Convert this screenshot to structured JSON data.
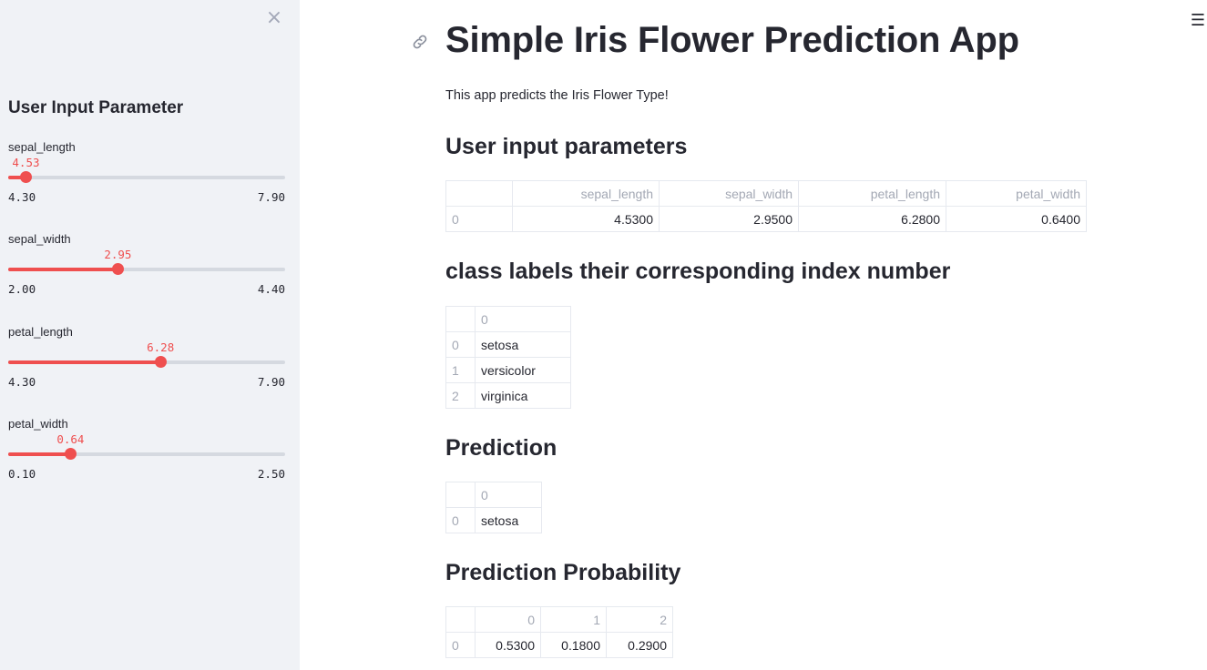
{
  "sidebar": {
    "close_glyph": "×",
    "title": "User Input Parameter",
    "sliders": [
      {
        "label": "sepal_length",
        "value": "4.53",
        "min": "4.30",
        "max": "7.90",
        "fraction": 0.064
      },
      {
        "label": "sepal_width",
        "value": "2.95",
        "min": "2.00",
        "max": "4.40",
        "fraction": 0.396
      },
      {
        "label": "petal_length",
        "value": "6.28",
        "min": "4.30",
        "max": "7.90",
        "fraction": 0.55
      },
      {
        "label": "petal_width",
        "value": "0.64",
        "min": "0.10",
        "max": "2.50",
        "fraction": 0.225
      }
    ]
  },
  "main": {
    "menu_glyph": "☰",
    "title": "Simple Iris Flower Prediction App",
    "intro": "This app predicts the Iris Flower Type!",
    "input_section": {
      "heading": "User input parameters",
      "columns": [
        "sepal_length",
        "sepal_width",
        "petal_length",
        "petal_width"
      ],
      "rows": [
        {
          "index": "0",
          "cells": [
            "4.5300",
            "2.9500",
            "6.2800",
            "0.6400"
          ]
        }
      ]
    },
    "labels_section": {
      "heading": "class labels their corresponding index number",
      "columns": [
        "0"
      ],
      "rows": [
        {
          "index": "0",
          "cells": [
            "setosa"
          ]
        },
        {
          "index": "1",
          "cells": [
            "versicolor"
          ]
        },
        {
          "index": "2",
          "cells": [
            "virginica"
          ]
        }
      ]
    },
    "prediction_section": {
      "heading": "Prediction",
      "columns": [
        "0"
      ],
      "rows": [
        {
          "index": "0",
          "cells": [
            "setosa"
          ]
        }
      ]
    },
    "probability_section": {
      "heading": "Prediction Probability",
      "columns": [
        "0",
        "1",
        "2"
      ],
      "rows": [
        {
          "index": "0",
          "cells": [
            "0.5300",
            "0.1800",
            "0.2900"
          ]
        }
      ]
    }
  },
  "colors": {
    "accent": "#ef4f4f",
    "sidebar_bg": "#f0f2f6",
    "text": "#262730",
    "muted": "#a3a8b4"
  },
  "icons": [
    "close-icon",
    "menu-icon",
    "link-icon"
  ]
}
